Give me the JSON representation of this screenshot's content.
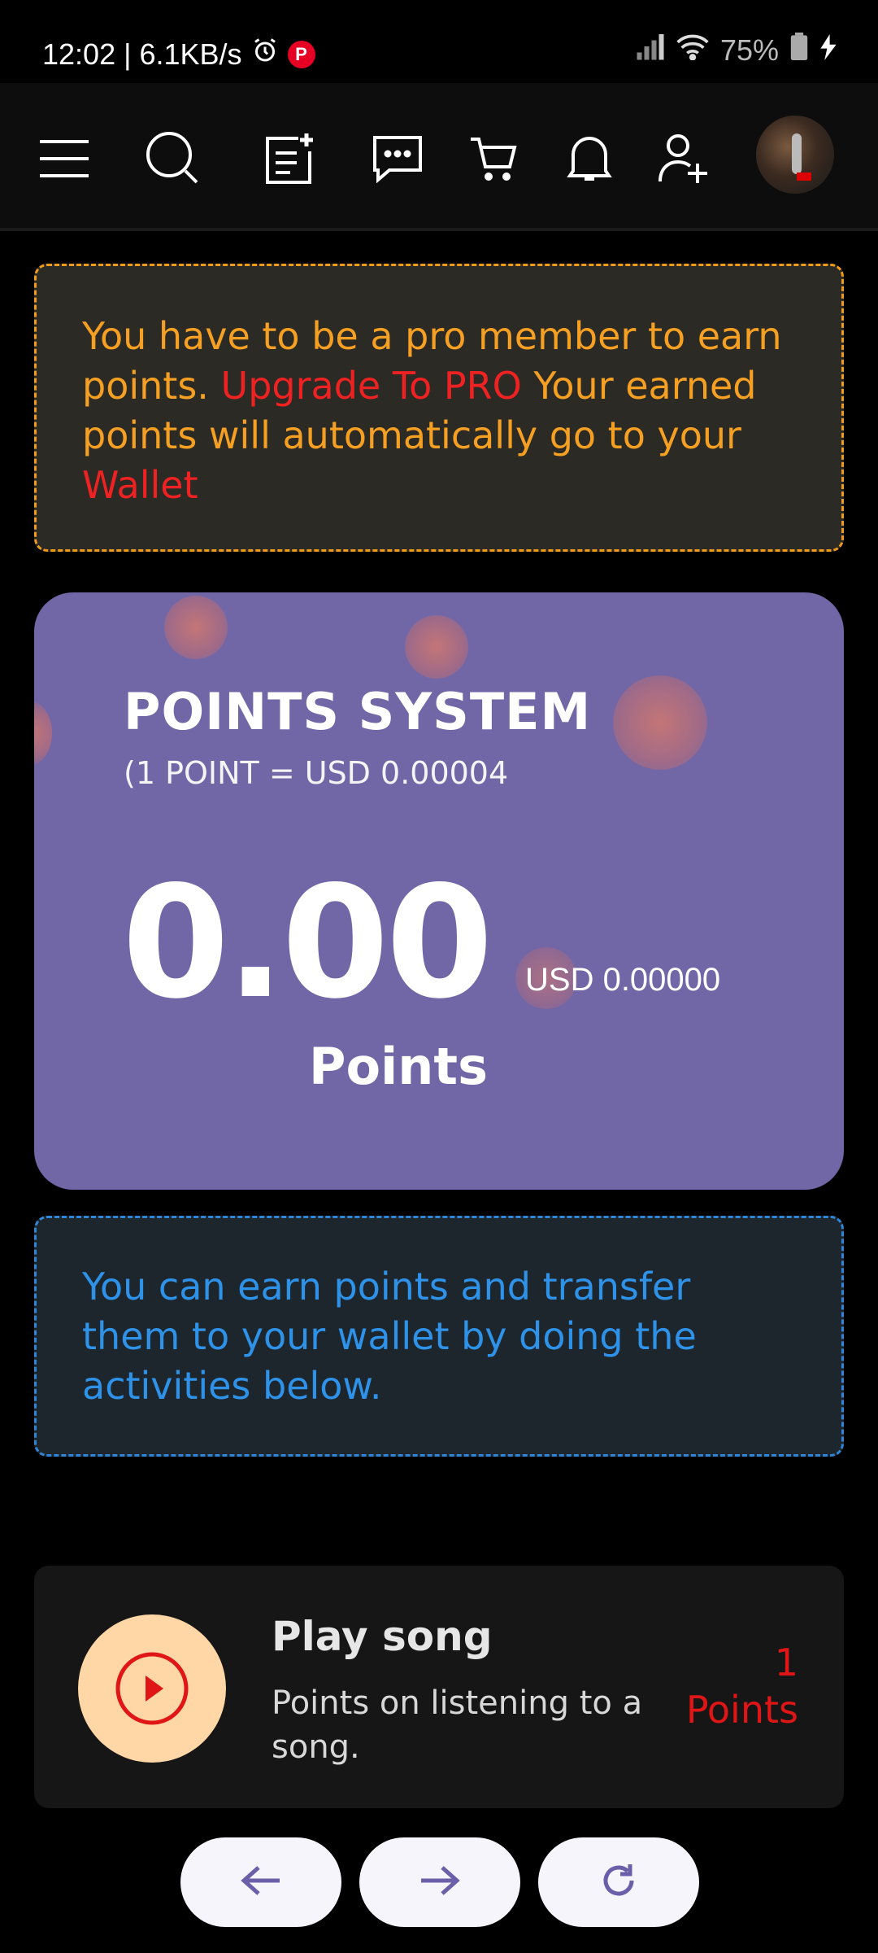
{
  "status_bar": {
    "time_speed": "12:02 | 6.1KB/s",
    "battery": "75%"
  },
  "notices": {
    "pro": {
      "part1": "You have to be a pro member to earn points. ",
      "link_upgrade": "Upgrade To PRO",
      "part2": " Your earned points will automatically go to your ",
      "link_wallet": "Wallet"
    },
    "earn": "You can earn points and transfer them to your wallet by doing the activities below."
  },
  "points_card": {
    "title": "POINTS SYSTEM",
    "rate": "(1 POINT = USD 0.00004",
    "value": "0.00",
    "usd": "USD 0.00000",
    "unit": "Points"
  },
  "activity": {
    "title": "Play song",
    "description": "Points on listening to a song.",
    "points_value": "1",
    "points_label": "Points"
  },
  "colors": {
    "card_purple": "#7166a6",
    "pro_orange": "#f5a023",
    "link_red": "#ee2222",
    "info_blue": "#2e92e8"
  },
  "icons": [
    "menu-icon",
    "search-icon",
    "new-post-icon",
    "messages-icon",
    "cart-icon",
    "bell-icon",
    "add-user-icon",
    "avatar",
    "play-icon",
    "arrow-left-icon",
    "arrow-right-icon",
    "refresh-icon"
  ]
}
